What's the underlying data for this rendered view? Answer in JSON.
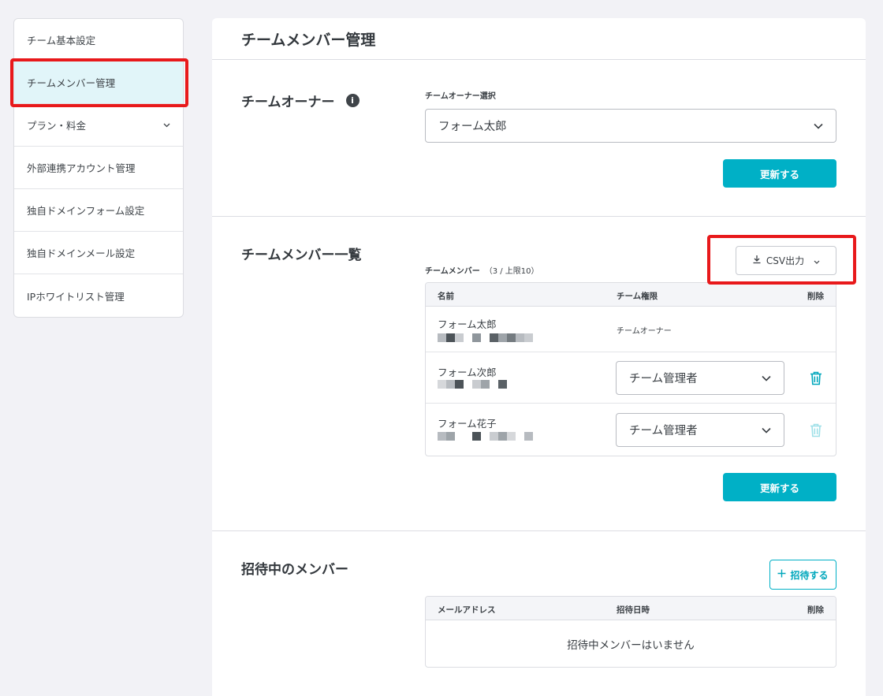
{
  "sidebar": {
    "items": [
      {
        "label": "チーム基本設定"
      },
      {
        "label": "チームメンバー管理"
      },
      {
        "label": "プラン・料金"
      },
      {
        "label": "外部連携アカウント管理"
      },
      {
        "label": "独自ドメインフォーム設定"
      },
      {
        "label": "独自ドメインメール設定"
      },
      {
        "label": "IPホワイトリスト管理"
      }
    ]
  },
  "page": {
    "title": "チームメンバー管理"
  },
  "owner": {
    "title": "チームオーナー",
    "select_label": "チームオーナー選択",
    "selected": "フォーム太郎",
    "update_button": "更新する"
  },
  "members": {
    "title": "チームメンバー一覧",
    "csv_button": "CSV出力",
    "label": "チームメンバー",
    "count": "（3 / 上限10）",
    "headers": {
      "name": "名前",
      "role": "チーム権限",
      "delete": "削除"
    },
    "rows": [
      {
        "name": "フォーム太郎",
        "role": "チームオーナー"
      },
      {
        "name": "フォーム次郎",
        "role": "チーム管理者"
      },
      {
        "name": "フォーム花子",
        "role": "チーム管理者"
      }
    ],
    "update_button": "更新する"
  },
  "invites": {
    "title": "招待中のメンバー",
    "invite_button": "招待する",
    "headers": {
      "email": "メールアドレス",
      "date": "招待日時",
      "delete": "削除"
    },
    "empty": "招待中メンバーはいません"
  },
  "colors": {
    "accent": "#00b0c6",
    "highlight": "#e8191b",
    "active_bg": "#e1f5f9"
  }
}
